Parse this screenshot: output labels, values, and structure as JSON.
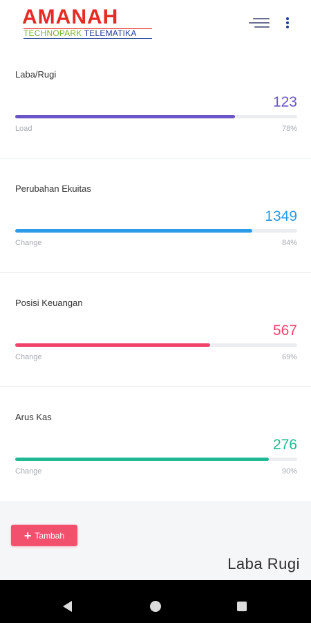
{
  "brand": {
    "name": "AMANAH",
    "sub_part1": "TECHNOPARK ",
    "sub_part2": "TELEMATIKA",
    "colors": {
      "main": "#e62b24",
      "sub1": "#7ab22f",
      "sub2": "#1f3f97"
    }
  },
  "header_icons": {
    "menu": "menu-lines-icon",
    "more": "vertical-dots-icon"
  },
  "cards": [
    {
      "title": "Laba/Rugi",
      "value": "123",
      "label": "Load",
      "percent_text": "78%",
      "percent": 78,
      "color": "#6a55c8"
    },
    {
      "title": "Perubahan Ekuitas",
      "value": "1349",
      "label": "Change",
      "percent_text": "84%",
      "percent": 84,
      "color": "#2c9be8"
    },
    {
      "title": "Posisi Keuangan",
      "value": "567",
      "label": "Change",
      "percent_text": "69%",
      "percent": 69,
      "color": "#f0426a"
    },
    {
      "title": "Arus Kas",
      "value": "276",
      "label": "Change",
      "percent_text": "90%",
      "percent": 90,
      "color": "#1fb892"
    }
  ],
  "actions": {
    "add_label": "Tambah",
    "add_icon": "plus-icon"
  },
  "section_title": "Laba Rugi",
  "system_nav": {
    "back": "back-triangle-icon",
    "home": "home-circle-icon",
    "recents": "recents-square-icon"
  }
}
